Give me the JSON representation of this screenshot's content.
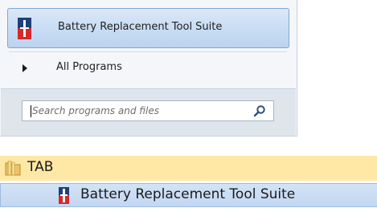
{
  "start_menu": {
    "pinned_program": {
      "label": "Battery Replacement Tool Suite",
      "icon": "battery-tool-icon"
    },
    "all_programs": {
      "label": "All Programs",
      "icon": "arrow-right-icon"
    },
    "search": {
      "placeholder": "Search programs and files",
      "value": "",
      "icon": "search-icon"
    }
  },
  "folder_tree": {
    "folder": {
      "label": "TAB",
      "icon": "folder-icon"
    },
    "selected_item": {
      "label": "Battery Replacement Tool Suite",
      "icon": "battery-tool-icon"
    }
  },
  "colors": {
    "highlight_blue": "#c9ddf4",
    "folder_highlight": "#ffe8a6",
    "search_band": "#dfe5ec",
    "icon_blue": "#1f3e7a",
    "icon_red": "#d42a2a"
  }
}
